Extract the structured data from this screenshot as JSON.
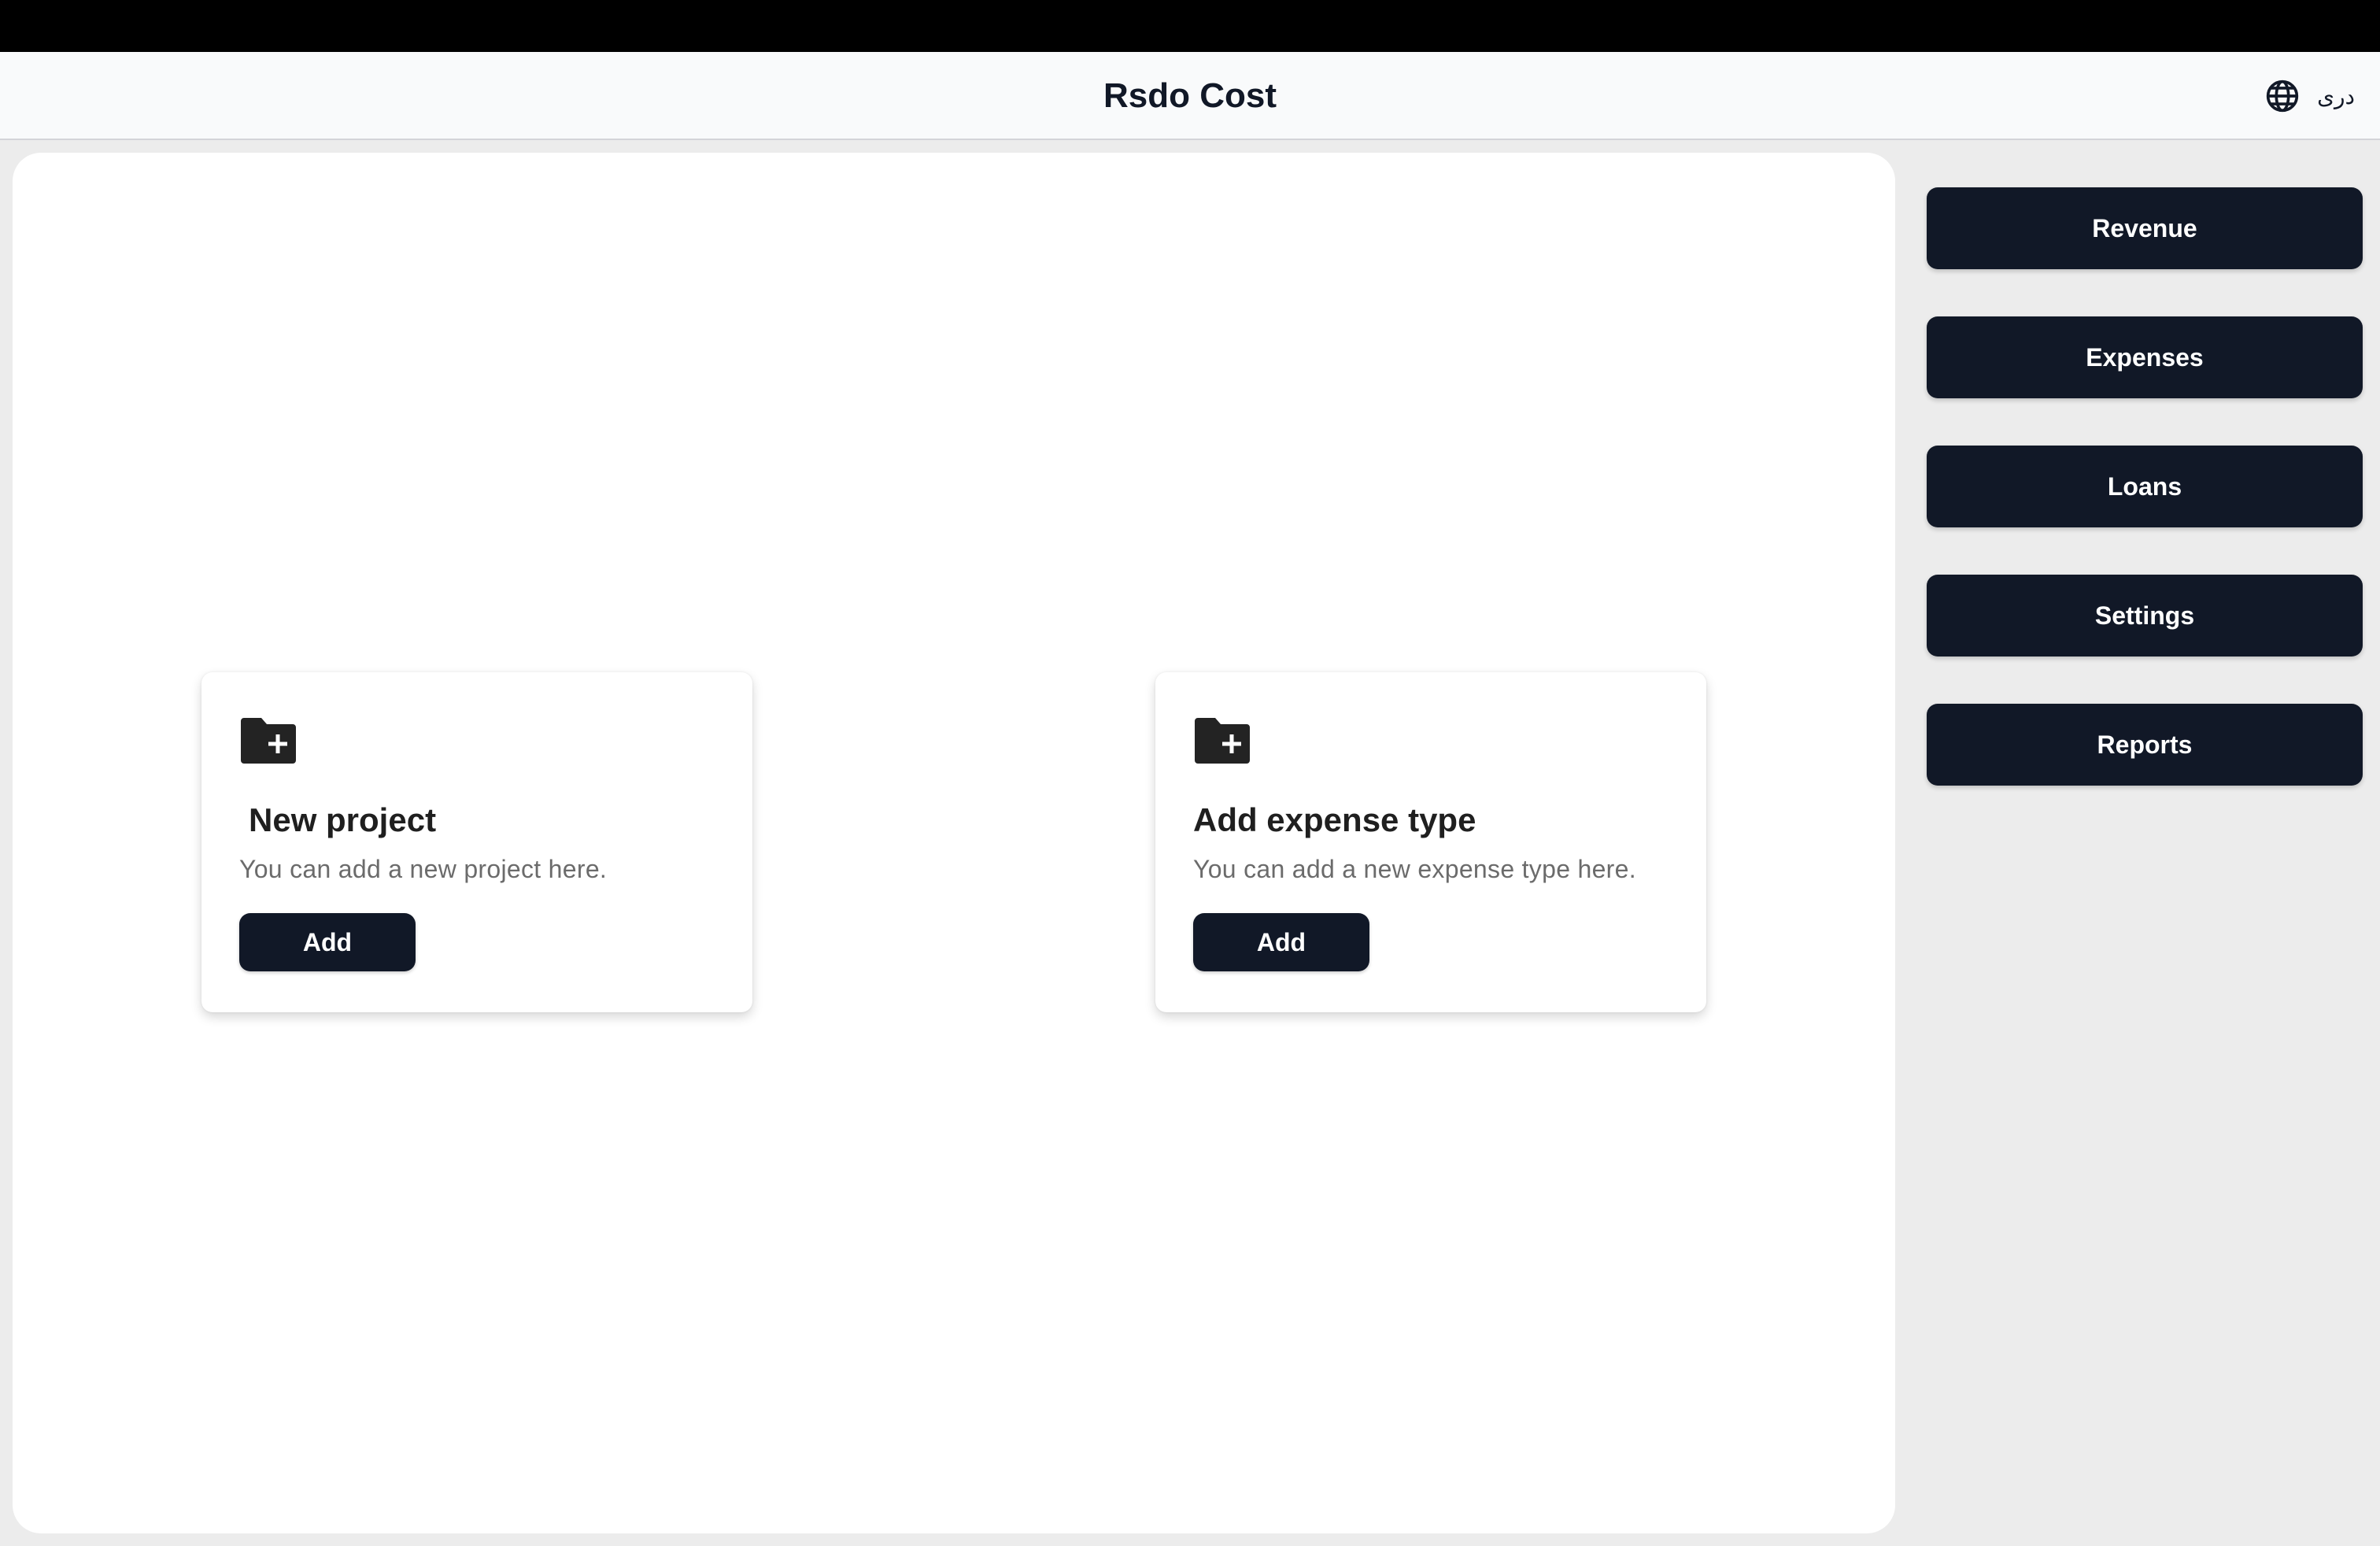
{
  "header": {
    "title": "Rsdo Cost",
    "language_label": "دری",
    "language_icon": "globe-icon"
  },
  "cards": [
    {
      "icon": "folder-add-icon",
      "title": "New project",
      "description": "You can add a new project here.",
      "button_label": "Add"
    },
    {
      "icon": "folder-add-icon",
      "title": "Add expense type",
      "description": "You can add a new expense type here.",
      "button_label": "Add"
    }
  ],
  "sidebar": {
    "items": [
      {
        "label": "Revenue"
      },
      {
        "label": "Expenses"
      },
      {
        "label": "Loans"
      },
      {
        "label": "Settings"
      },
      {
        "label": "Reports"
      }
    ]
  },
  "colors": {
    "button_bg": "#111827",
    "button_text": "#ffffff",
    "header_bg": "#f9fafb",
    "page_bg": "#ececec",
    "panel_bg": "#ffffff"
  }
}
